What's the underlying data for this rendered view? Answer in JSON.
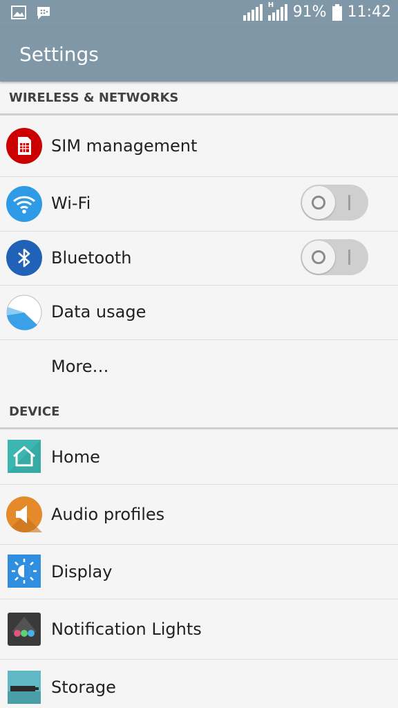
{
  "status_bar": {
    "battery": "91%",
    "time": "11:42",
    "network_type": "H",
    "icons": [
      "gallery-icon",
      "messenger-icon",
      "signal-icon",
      "battery-icon"
    ]
  },
  "app_bar": {
    "title": "Settings"
  },
  "sections": {
    "wireless": {
      "header": "WIRELESS & NETWORKS",
      "items": [
        {
          "label": "SIM management",
          "icon": "sim-card-icon"
        },
        {
          "label": "Wi-Fi",
          "icon": "wifi-icon",
          "toggle": "off"
        },
        {
          "label": "Bluetooth",
          "icon": "bluetooth-icon",
          "toggle": "off"
        },
        {
          "label": "Data usage",
          "icon": "data-usage-icon"
        },
        {
          "label": "More…"
        }
      ]
    },
    "device": {
      "header": "DEVICE",
      "items": [
        {
          "label": "Home",
          "icon": "home-icon"
        },
        {
          "label": "Audio profiles",
          "icon": "speaker-icon"
        },
        {
          "label": "Display",
          "icon": "brightness-icon"
        },
        {
          "label": "Notification Lights",
          "icon": "notification-lights-icon"
        },
        {
          "label": "Storage",
          "icon": "storage-icon"
        }
      ]
    }
  },
  "colors": {
    "toolbar": "#7f97a6",
    "sim": "#cc0000",
    "wifi": "#2f9be6",
    "bluetooth": "#1f62b7",
    "home": "#3db6b1",
    "audio": "#e48a2a",
    "display": "#2f8ee0",
    "storage": "#5fb8c3"
  }
}
